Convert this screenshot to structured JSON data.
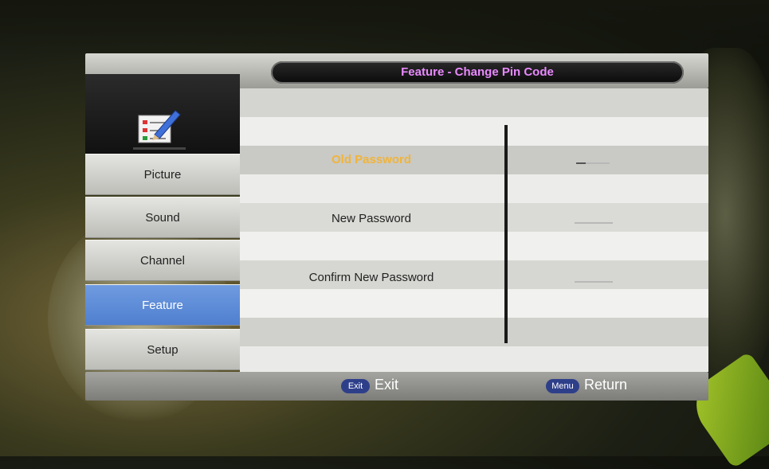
{
  "title": "Feature - Change Pin Code",
  "sidebar": {
    "items": [
      {
        "label": "Picture"
      },
      {
        "label": "Sound"
      },
      {
        "label": "Channel"
      },
      {
        "label": "Feature",
        "active": true
      },
      {
        "label": "Setup"
      }
    ]
  },
  "form": {
    "old_password": "Old Password",
    "new_password": "New Password",
    "confirm_password": "Confirm New Password"
  },
  "footer": {
    "exit_key": "Exit",
    "exit_label": "Exit",
    "menu_key": "Menu",
    "menu_label": "Return"
  },
  "colors": {
    "title_text": "#e989ff",
    "highlight_text": "#f1b43a",
    "active_menu": "#5f8cd8",
    "key_pill": "#2e3f8a"
  },
  "icons": [
    "checklist-pencil-icon"
  ]
}
